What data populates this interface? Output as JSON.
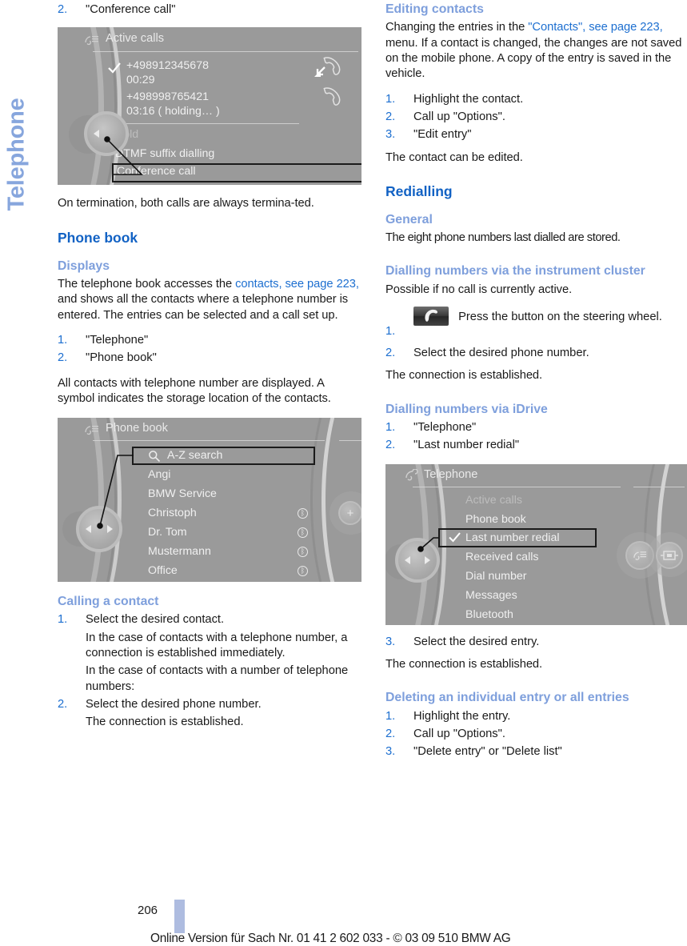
{
  "chapter_tab": {
    "label": "Telephone"
  },
  "left_column": {
    "step2_conference": {
      "num": "2.",
      "text": "\"Conference call\""
    },
    "active_calls_display": {
      "title": "Active calls",
      "title_icon": "telephone-list-icon",
      "call1": {
        "number": "+498912345678",
        "duration": "00:29",
        "checked": true,
        "icon": "incoming-call-icon"
      },
      "call2": {
        "number": "+498998765421",
        "duration": "03:16 ( holding… )",
        "checked": false,
        "icon": "handset-icon"
      },
      "menu": [
        "Hold",
        "DTMF suffix dialling",
        "Conference call"
      ],
      "selected_menu_item": "Conference call",
      "disabled_menu_item": "Hold"
    },
    "after_display_text": "On termination, both calls are always termina-ted.",
    "heading_phone_book": "Phone book",
    "heading_displays": "Displays",
    "displays_paragraph_1": "The telephone book accesses the ",
    "displays_link_1": "contacts, see page 223,",
    "displays_paragraph_2": " and shows all the contacts where a telephone number is entered. The entries can be selected and a call set up.",
    "displays_steps": [
      {
        "num": "1.",
        "text": "\"Telephone\""
      },
      {
        "num": "2.",
        "text": "\"Phone book\""
      }
    ],
    "displays_after": "All contacts with telephone number are displayed. A symbol indicates the storage location of the contacts.",
    "phone_book_display": {
      "title": "Phone book",
      "title_icon": "telephone-list-icon",
      "search_row": {
        "label": "A-Z search",
        "icon": "magnifier-icon",
        "selected": true
      },
      "contacts": [
        {
          "name": "Angi",
          "bluetooth": false
        },
        {
          "name": "BMW Service",
          "bluetooth": false
        },
        {
          "name": "Christoph",
          "bluetooth": true
        },
        {
          "name": "Dr. Tom",
          "bluetooth": true
        },
        {
          "name": "Mustermann",
          "bluetooth": true
        },
        {
          "name": "Office",
          "bluetooth": true
        }
      ],
      "right_button_icon": "plus-icon"
    },
    "heading_calling_contact": "Calling a contact",
    "calling_steps": [
      {
        "num": "1.",
        "text": "Select the desired contact.",
        "subs": [
          "In the case of contacts with a telephone number, a connection is established immediately.",
          "In the case of contacts with a number of telephone numbers:"
        ]
      },
      {
        "num": "2.",
        "text": "Select the desired phone number.",
        "subs": [
          "The connection is established."
        ]
      }
    ]
  },
  "right_column": {
    "heading_editing_contacts": "Editing contacts",
    "editing_paragraph_1": "Changing the entries in the ",
    "editing_link_1": "\"Contacts\", see page 223,",
    "editing_paragraph_2": " menu. If a contact is changed, the changes are not saved on the mobile phone. A copy of the entry is saved in the vehicle.",
    "editing_steps": [
      {
        "num": "1.",
        "text": "Highlight the contact."
      },
      {
        "num": "2.",
        "text": "Call up \"Options\"."
      },
      {
        "num": "3.",
        "text": "\"Edit entry\""
      }
    ],
    "editing_after": "The contact can be edited.",
    "heading_redialling": "Redialling",
    "heading_general": "General",
    "general_text": "The eight phone numbers last dialled are stored.",
    "heading_instrument_cluster": "Dialling numbers via the instrument cluster",
    "instrument_cluster_intro": "Possible if no call is currently active.",
    "instrument_cluster_steps": [
      {
        "num": "1.",
        "icon": "steering-wheel-call-button-icon",
        "text": "Press the button on the steering wheel."
      },
      {
        "num": "2.",
        "text": "Select the desired phone number."
      }
    ],
    "instrument_cluster_after": "The connection is established.",
    "heading_idrive": "Dialling numbers via iDrive",
    "idrive_steps": [
      {
        "num": "1.",
        "text": "\"Telephone\""
      },
      {
        "num": "2.",
        "text": "\"Last number redial\""
      }
    ],
    "telephone_menu_display": {
      "title": "Telephone",
      "title_icon": "handset-icon",
      "items": [
        {
          "label": "Active calls",
          "disabled": true,
          "checked": false,
          "selected": false
        },
        {
          "label": "Phone book",
          "disabled": false,
          "checked": false,
          "selected": false
        },
        {
          "label": "Last number redial",
          "disabled": false,
          "checked": true,
          "selected": true
        },
        {
          "label": "Received calls",
          "disabled": false,
          "checked": false,
          "selected": false
        },
        {
          "label": "Dial number",
          "disabled": false,
          "checked": false,
          "selected": false
        },
        {
          "label": "Messages",
          "disabled": false,
          "checked": false,
          "selected": false
        },
        {
          "label": "Bluetooth",
          "disabled": false,
          "checked": false,
          "selected": false
        }
      ],
      "side_buttons": [
        "telephone-list-icon",
        "display-toggle-icon"
      ]
    },
    "idrive_step3": {
      "num": "3.",
      "text": "Select the desired entry."
    },
    "idrive_after": "The connection is established.",
    "heading_deleting": "Deleting an individual entry or all entries",
    "deleting_steps": [
      {
        "num": "1.",
        "text": "Highlight the entry."
      },
      {
        "num": "2.",
        "text": "Call up \"Options\"."
      },
      {
        "num": "3.",
        "text": "\"Delete entry\" or \"Delete list\""
      }
    ]
  },
  "footer": {
    "page_number": "206",
    "note": "Online Version für Sach Nr. 01 41 2 602 033 - © 03 09 510 BMW AG"
  },
  "colors": {
    "heading_primary": "#1262c4",
    "heading_secondary": "#7e9fdc",
    "link": "#1d6fd0",
    "chapter_tab": "#87a6dd",
    "page_marker": "#aebce0",
    "screen_bg": "#9a9a9a"
  }
}
